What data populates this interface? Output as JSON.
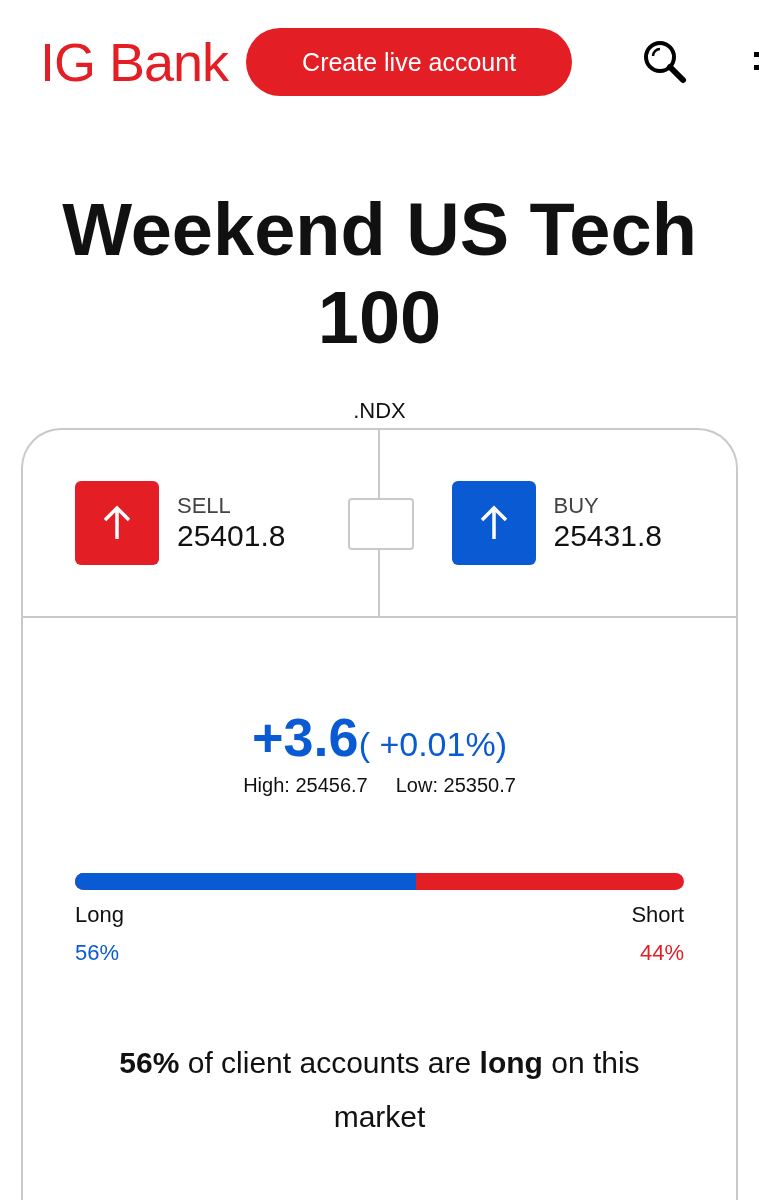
{
  "header": {
    "logo": "IG Bank",
    "cta": "Create live account"
  },
  "market": {
    "title": "Weekend US Tech 100",
    "symbol": ".NDX"
  },
  "quotes": [
    {
      "kind": "sell",
      "label": "SELL",
      "price": "25401.8"
    },
    {
      "kind": "buy",
      "label": "BUY",
      "price": "25431.8"
    }
  ],
  "change": {
    "value": "+3.6",
    "percent": "( +0.01%)",
    "high": "High: 25456.7",
    "low": "Low: 25350.7"
  },
  "sentiment": {
    "level": 0.56,
    "long_label": "Long",
    "long_value": "56%",
    "short_label": "Short",
    "short_value": "44%",
    "summary": "**56%** of client accounts are **long** on this market"
  }
}
